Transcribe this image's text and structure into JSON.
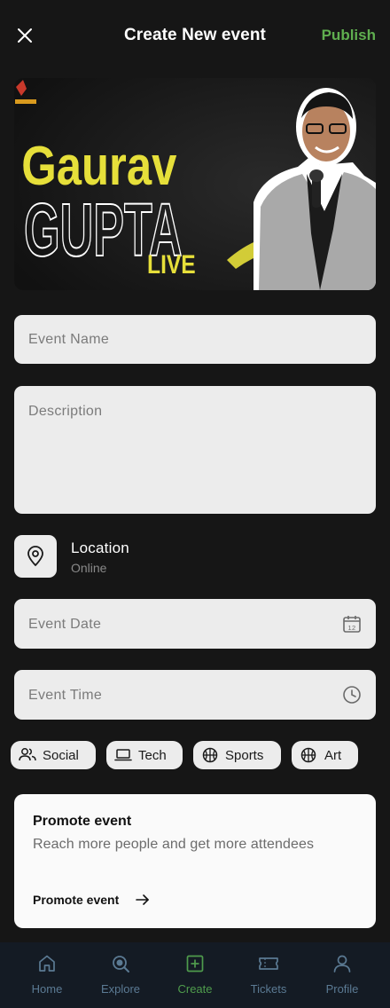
{
  "header": {
    "title": "Create New event",
    "publish_label": "Publish"
  },
  "banner": {
    "first_name": "Gaurav",
    "last_name": "GUPTA",
    "tag": "LIVE"
  },
  "form": {
    "event_name_placeholder": "Event  Name",
    "description_placeholder": "Description",
    "event_date_placeholder": "Event  Date",
    "event_time_placeholder": "Event  Time",
    "calendar_icon_day": "12"
  },
  "location": {
    "title": "Location",
    "value": "Online"
  },
  "categories": [
    {
      "label": "Social",
      "icon": "people-icon"
    },
    {
      "label": "Tech",
      "icon": "laptop-icon"
    },
    {
      "label": "Sports",
      "icon": "basketball-icon"
    },
    {
      "label": "Art",
      "icon": "basketball-icon"
    }
  ],
  "promote": {
    "title": "Promote event",
    "subtitle": "Reach more people and get more attendees",
    "link_label": "Promote event"
  },
  "nav": {
    "items": [
      {
        "label": "Home",
        "icon": "home-icon"
      },
      {
        "label": "Explore",
        "icon": "explore-icon"
      },
      {
        "label": "Create",
        "icon": "create-icon"
      },
      {
        "label": "Tickets",
        "icon": "ticket-icon"
      },
      {
        "label": "Profile",
        "icon": "profile-icon"
      }
    ],
    "active_color": "#4f9c4c",
    "inactive_color": "#5b7a93"
  },
  "colors": {
    "background": "#161616",
    "accent": "#5fae4f",
    "banner_yellow": "#e6df3a",
    "field_bg": "#ececec"
  }
}
